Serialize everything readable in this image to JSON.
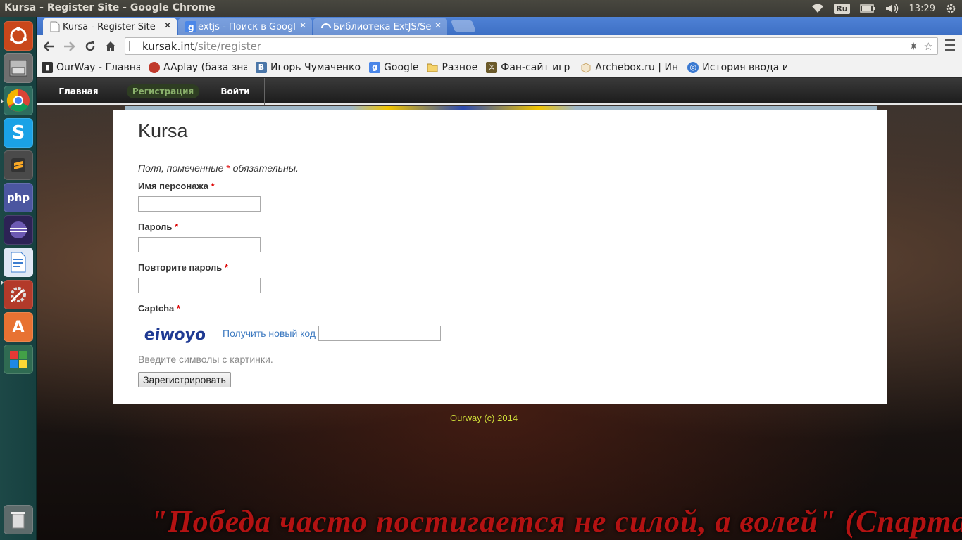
{
  "os": {
    "window_title": "Kursa - Register Site - Google Chrome",
    "keyboard_layout": "Ru",
    "clock": "13:29"
  },
  "launcher": {
    "items": [
      {
        "name": "dash-home-icon",
        "color": "#d9531e"
      },
      {
        "name": "files-icon",
        "color": "#7a7a7a"
      },
      {
        "name": "chrome-icon",
        "color": "#e04a3a"
      },
      {
        "name": "skype-icon",
        "color": "#1aa2e6"
      },
      {
        "name": "sublime-text-icon",
        "color": "#5b5b5b"
      },
      {
        "name": "phpstorm-icon",
        "color": "#5a63a8"
      },
      {
        "name": "eclipse-icon",
        "color": "#2c2255"
      },
      {
        "name": "libreoffice-writer-icon",
        "color": "#3b7dd0"
      },
      {
        "name": "system-settings-icon",
        "color": "#c43c2b"
      },
      {
        "name": "software-center-icon",
        "color": "#e87232"
      },
      {
        "name": "playonlinux-icon",
        "color": "#3b8a3e"
      },
      {
        "name": "trash-icon",
        "color": "#8c8c8c"
      }
    ]
  },
  "browser": {
    "tabs": [
      {
        "title": "Kursa - Register Site",
        "active": true
      },
      {
        "title": "extjs - Поиск в Google",
        "active": false
      },
      {
        "title": "Библиотека ExtJS/Se",
        "active": false
      }
    ],
    "url_host": "kursak.int",
    "url_path": "/site/register",
    "bookmarks": [
      {
        "label": "OurWay - Главная с"
      },
      {
        "label": "AAplay (база знани"
      },
      {
        "label": "Игорь Чумаченко"
      },
      {
        "label": "Google"
      },
      {
        "label": "Разное"
      },
      {
        "label": "Фан-сайт игр \"Вой"
      },
      {
        "label": "Archebox.ru | Инте"
      },
      {
        "label": "История ввода и в"
      }
    ]
  },
  "site": {
    "nav": {
      "home": "Главная",
      "register": "Регистрация",
      "login": "Войти"
    },
    "title": "Kursa",
    "form": {
      "required_note_before": "Поля, помеченные",
      "required_star": "*",
      "required_note_after": "обязательны.",
      "character_name_label": "Имя персонажа",
      "password_label": "Пароль",
      "repeat_password_label": "Повторите пароль",
      "captcha_label": "Captcha",
      "captcha_text": "eiwoyo",
      "captcha_refresh": "Получить новый код",
      "captcha_hint": "Введите символы с картинки.",
      "submit": "Зарегистрировать"
    },
    "footer": "Ourway (c) 2014",
    "background_quote": "\"Победа часто постигается не силой, а волей\" (Спартак)"
  }
}
